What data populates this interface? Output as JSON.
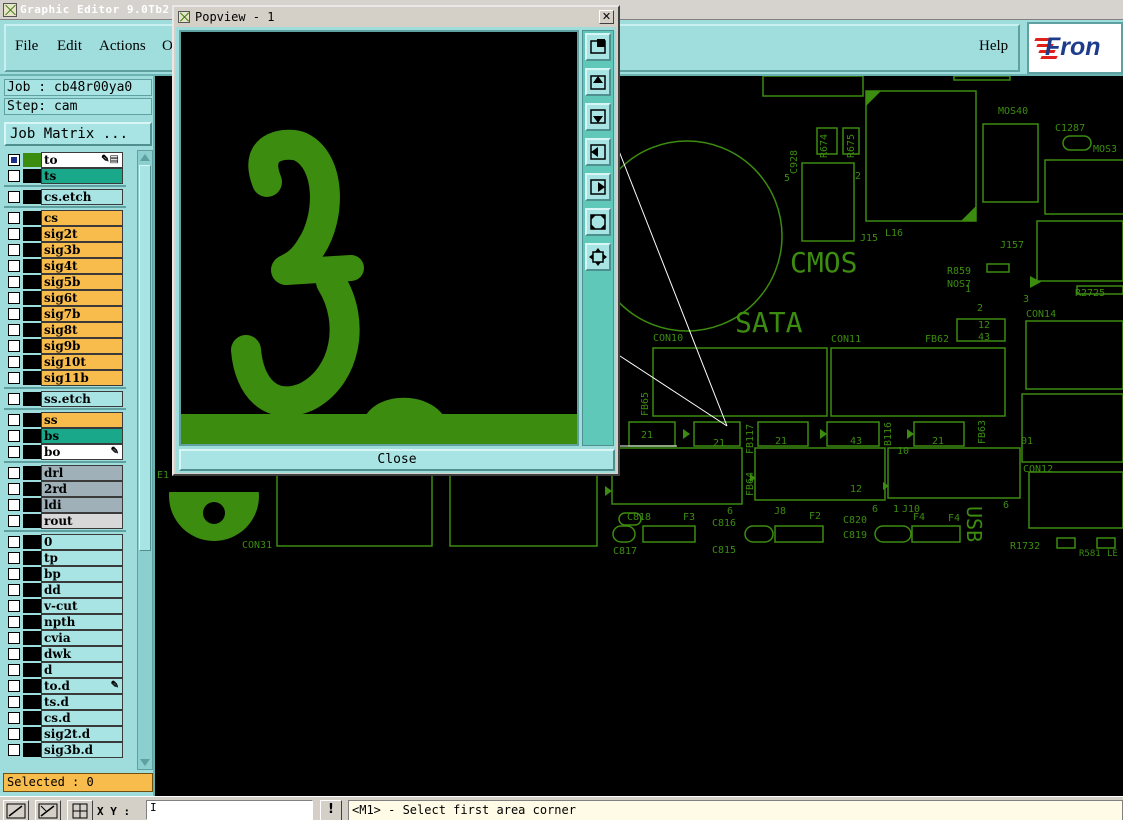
{
  "app": {
    "title": "Graphic Editor 9.0Tb2"
  },
  "menu": {
    "file": "File",
    "edit": "Edit",
    "actions": "Actions",
    "options_partial": "O",
    "help": "Help"
  },
  "logo": {
    "text": "Fron"
  },
  "job": {
    "job_line": "Job : cb48r00ya0",
    "step_line": "Step: cam",
    "matrix_button": "Job Matrix ..."
  },
  "layers": [
    {
      "name": "to",
      "color": "#ffffff",
      "selected": true,
      "active": true,
      "mark": "✎▤"
    },
    {
      "name": "ts",
      "color": "#1aa88a",
      "selected": false,
      "active": false,
      "mark": ""
    },
    {
      "name": "cs.etch",
      "color": "#a8e4e4",
      "selected": false,
      "active": false,
      "mark": ""
    },
    {
      "name": "cs",
      "color": "#f8bc4c",
      "selected": false,
      "active": false,
      "mark": ""
    },
    {
      "name": "sig2t",
      "color": "#f8bc4c",
      "selected": false,
      "active": false,
      "mark": ""
    },
    {
      "name": "sig3b",
      "color": "#f8bc4c",
      "selected": false,
      "active": false,
      "mark": ""
    },
    {
      "name": "sig4t",
      "color": "#f8bc4c",
      "selected": false,
      "active": false,
      "mark": ""
    },
    {
      "name": "sig5b",
      "color": "#f8bc4c",
      "selected": false,
      "active": false,
      "mark": ""
    },
    {
      "name": "sig6t",
      "color": "#f8bc4c",
      "selected": false,
      "active": false,
      "mark": ""
    },
    {
      "name": "sig7b",
      "color": "#f8bc4c",
      "selected": false,
      "active": false,
      "mark": ""
    },
    {
      "name": "sig8t",
      "color": "#f8bc4c",
      "selected": false,
      "active": false,
      "mark": ""
    },
    {
      "name": "sig9b",
      "color": "#f8bc4c",
      "selected": false,
      "active": false,
      "mark": ""
    },
    {
      "name": "sig10t",
      "color": "#f8bc4c",
      "selected": false,
      "active": false,
      "mark": ""
    },
    {
      "name": "sig11b",
      "color": "#f8bc4c",
      "selected": false,
      "active": false,
      "mark": ""
    },
    {
      "name": "ss.etch",
      "color": "#a8e4e4",
      "selected": false,
      "active": false,
      "mark": ""
    },
    {
      "name": "ss",
      "color": "#f8bc4c",
      "selected": false,
      "active": false,
      "mark": ""
    },
    {
      "name": "bs",
      "color": "#1aa88a",
      "selected": false,
      "active": false,
      "mark": ""
    },
    {
      "name": "bo",
      "color": "#ffffff",
      "selected": false,
      "active": false,
      "mark": "✎"
    },
    {
      "name": "drl",
      "color": "#a0b0b8",
      "selected": false,
      "active": false,
      "mark": ""
    },
    {
      "name": "2rd",
      "color": "#a0b0b8",
      "selected": false,
      "active": false,
      "mark": ""
    },
    {
      "name": "ldi",
      "color": "#a0b0b8",
      "selected": false,
      "active": false,
      "mark": ""
    },
    {
      "name": "rout",
      "color": "#d8d8d8",
      "selected": false,
      "active": false,
      "mark": ""
    },
    {
      "name": "0",
      "color": "#a8e4e4",
      "selected": false,
      "active": false,
      "mark": ""
    },
    {
      "name": "tp",
      "color": "#a8e4e4",
      "selected": false,
      "active": false,
      "mark": ""
    },
    {
      "name": "bp",
      "color": "#a8e4e4",
      "selected": false,
      "active": false,
      "mark": ""
    },
    {
      "name": "dd",
      "color": "#a8e4e4",
      "selected": false,
      "active": false,
      "mark": ""
    },
    {
      "name": "v-cut",
      "color": "#a8e4e4",
      "selected": false,
      "active": false,
      "mark": ""
    },
    {
      "name": "npth",
      "color": "#a8e4e4",
      "selected": false,
      "active": false,
      "mark": ""
    },
    {
      "name": "cvia",
      "color": "#a8e4e4",
      "selected": false,
      "active": false,
      "mark": ""
    },
    {
      "name": "dwk",
      "color": "#a8e4e4",
      "selected": false,
      "active": false,
      "mark": ""
    },
    {
      "name": "d",
      "color": "#a8e4e4",
      "selected": false,
      "active": false,
      "mark": ""
    },
    {
      "name": "to.d",
      "color": "#a8e4e4",
      "selected": false,
      "active": false,
      "mark": "✎"
    },
    {
      "name": "ts.d",
      "color": "#a8e4e4",
      "selected": false,
      "active": false,
      "mark": ""
    },
    {
      "name": "cs.d",
      "color": "#a8e4e4",
      "selected": false,
      "active": false,
      "mark": ""
    },
    {
      "name": "sig2t.d",
      "color": "#a8e4e4",
      "selected": false,
      "active": false,
      "mark": ""
    },
    {
      "name": "sig3b.d",
      "color": "#a8e4e4",
      "selected": false,
      "active": false,
      "mark": ""
    }
  ],
  "selected": {
    "text": "Selected : 0"
  },
  "popview": {
    "title": "Popview - 1",
    "close_x": "✕",
    "close_button": "Close"
  },
  "board_labels": {
    "cmos": "CMOS",
    "sata": "SATA",
    "usb": "USB",
    "l16": "L16",
    "j15": "J15",
    "c928": "C928",
    "r674": "R674",
    "r675": "R675",
    "mos40": "MOS40",
    "c1287": "C1287",
    "mos3": "MOS3",
    "j157": "J157",
    "r859": "R859",
    "nos7": "NOS7",
    "r2725": "R2725",
    "con14": "CON14",
    "con10": "CON10",
    "con11": "CON11",
    "fb62": "FB62",
    "fb65": "FB65",
    "fb64": "FB64",
    "fb117": "FB117",
    "b116": "B116",
    "fb63": "FB63",
    "con12": "CON12",
    "c818": "C818",
    "f3": "F3",
    "c816": "C816",
    "j8": "J8",
    "f2": "F2",
    "c820": "C820",
    "j10": "J10",
    "f4": "F4",
    "c817": "C817",
    "c815": "C815",
    "c819": "C819",
    "r1732": "R1732",
    "r581": "R581",
    "le": "LE",
    "con31": "CON31",
    "e1": "E1",
    "r12": "12",
    "r43": "43",
    "r21": "21",
    "r21b": "21",
    "r21c": "21",
    "r43b": "43",
    "r21d": "21",
    "pad1": "1",
    "pad2": "2",
    "pad3": "3",
    "pad5": "5",
    "pad6": "6",
    "pad6b": "6",
    "pad6c": "6",
    "pad2b": "2",
    "pad1b": "1",
    "pad01": "01",
    "pad10": "10",
    "pad12": "12",
    "f4b": "F4"
  },
  "status": {
    "xy_label": "X Y :",
    "xy_value": "I",
    "info": "!",
    "prompt": "<M1> - Select first area corner"
  },
  "colors": {
    "panel": "#9fdcdc",
    "pcb_trace": "#3c8c10",
    "selected_bg": "#f8bc4c"
  }
}
